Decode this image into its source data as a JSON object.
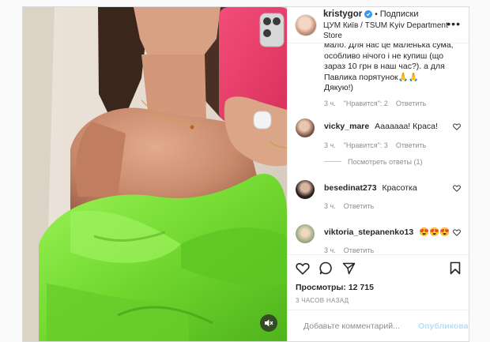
{
  "header": {
    "username": "kristygor",
    "separator": "•",
    "follow_label": "Подписки",
    "location": "ЦУМ Київ / TSUM Kyiv Department Store",
    "more_label": "•••"
  },
  "caption": {
    "lines": [
      "мало. Для нас це маленька сума,",
      "особливо нічого і не купиш (що",
      "зараз 10 грн в наш час?). а для",
      "Павлика порятунок🙏🙏",
      "Дякую!)"
    ],
    "time": "3 ч.",
    "likes": "\"Нравится\": 2",
    "reply": "Ответить"
  },
  "comments": [
    {
      "username": "vicky_mare",
      "text": "Ааааааа! Краса!",
      "time": "3 ч.",
      "likes": "\"Нравится\": 3",
      "reply": "Ответить",
      "view_replies": "Посмотреть ответы (1)"
    },
    {
      "username": "besedinat273",
      "text": "Красотка",
      "time": "3 ч.",
      "reply": "Ответить"
    },
    {
      "username": "viktoria_stepanenko13",
      "text": "😍😍😍",
      "time": "3 ч.",
      "reply": "Ответить"
    }
  ],
  "stats": {
    "views_label": "Просмотры:",
    "views_value": "12 715",
    "time_ago": "3 ЧАСОВ НАЗАД"
  },
  "add_comment": {
    "placeholder": "Добавьте комментарий...",
    "publish_label": "Опубликовать"
  },
  "colors": {
    "dress_green": "#7ce23b",
    "phone_pink": "#ef3f6e",
    "verified_blue": "#3897f0",
    "publish_disabled": "#b2dffc"
  }
}
